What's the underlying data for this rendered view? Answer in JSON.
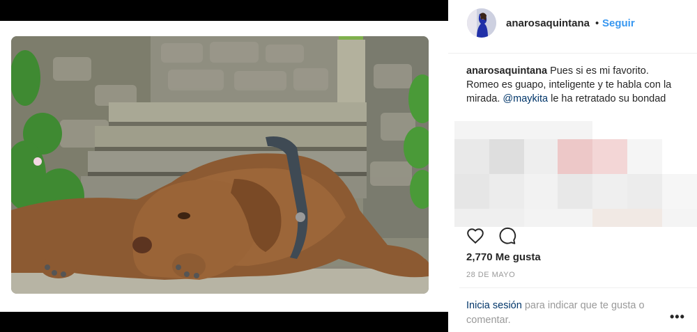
{
  "post": {
    "username": "anarosaquintana",
    "separator": "•",
    "follow_label": "Seguir",
    "caption": {
      "username": "anarosaquintana",
      "text_before_mention": "Pues si es mi favorito. Romeo es guapo, inteligente y te habla con la mirada.",
      "mention": "@maykita",
      "text_after_mention": "le ha retratado su bondad"
    },
    "likes_label": "2,770 Me gusta",
    "date": "28 DE MAYO",
    "login_prompt": {
      "link": "Inicia sesión",
      "text": "para indicar que te gusta o comentar."
    },
    "more_label": "•••"
  },
  "icons": {
    "like": "heart-icon",
    "comment": "comment-icon",
    "more": "more-options-icon"
  },
  "colors": {
    "link": "#3897f0",
    "mention": "#003569",
    "muted": "#999999",
    "text": "#262626"
  }
}
